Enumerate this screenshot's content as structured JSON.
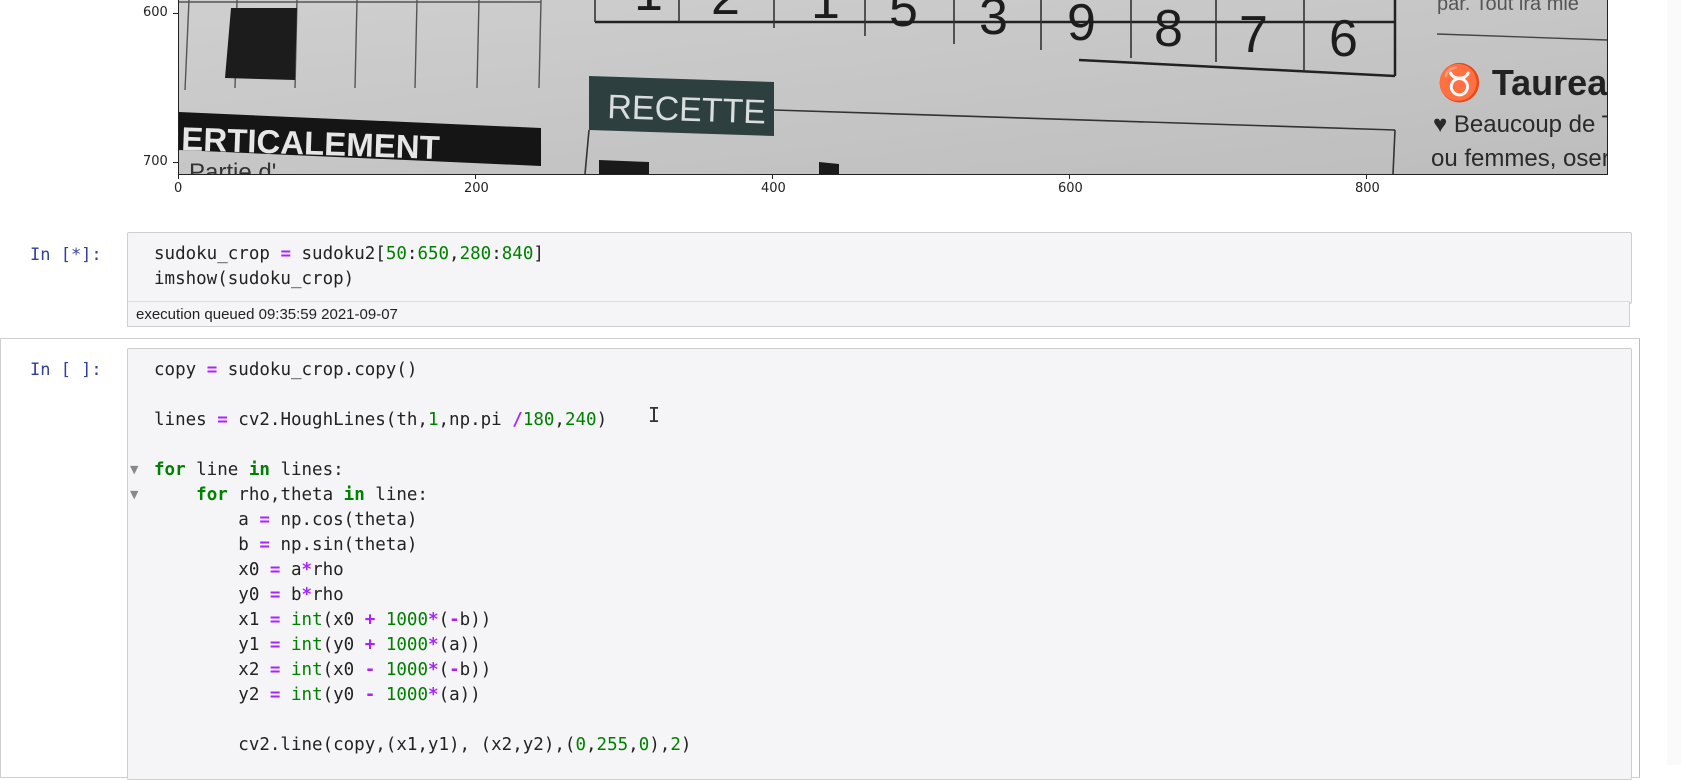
{
  "plot": {
    "y_ticks": [
      "600",
      "700"
    ],
    "x_ticks": [
      "0",
      "200",
      "400",
      "600",
      "800"
    ],
    "photo_text": {
      "verticalement": "ERTICALEMENT",
      "partie": "Partie d'",
      "recette": "RECETTE",
      "taureau": "♉ Taureau",
      "beaucoup": "♥ Beaucoup de Ta",
      "femmes": "ou femmes, osere",
      "tout": "par. Tout ira mie",
      "digits": [
        "1",
        "2",
        "1",
        "5",
        "3",
        "9",
        "8",
        "7",
        "6"
      ]
    }
  },
  "cells": [
    {
      "prompt": "In [*]:",
      "lines": [
        [
          {
            "t": "sudoku_crop "
          },
          {
            "t": "=",
            "c": "o"
          },
          {
            "t": " sudoku2["
          },
          {
            "t": "50",
            "c": "n"
          },
          {
            "t": ":"
          },
          {
            "t": "650",
            "c": "n"
          },
          {
            "t": ","
          },
          {
            "t": "280",
            "c": "n"
          },
          {
            "t": ":"
          },
          {
            "t": "840",
            "c": "n"
          },
          {
            "t": "]"
          }
        ],
        [
          {
            "t": "imshow(sudoku_crop)"
          }
        ]
      ],
      "status": "execution queued 09:35:59 2021-09-07"
    },
    {
      "prompt": "In [ ]:",
      "lines": [
        [
          {
            "t": "copy "
          },
          {
            "t": "=",
            "c": "o"
          },
          {
            "t": " sudoku_crop.copy()"
          }
        ],
        [],
        [
          {
            "t": "lines "
          },
          {
            "t": "=",
            "c": "o"
          },
          {
            "t": " cv2.HoughLines(th,"
          },
          {
            "t": "1",
            "c": "n"
          },
          {
            "t": ",np.pi "
          },
          {
            "t": "/",
            "c": "o"
          },
          {
            "t": "180",
            "c": "n"
          },
          {
            "t": ","
          },
          {
            "t": "240",
            "c": "n"
          },
          {
            "t": ")"
          }
        ],
        [],
        [
          {
            "t": "for",
            "c": "k"
          },
          {
            "t": " line "
          },
          {
            "t": "in",
            "c": "k"
          },
          {
            "t": " lines:"
          }
        ],
        [
          {
            "t": "    "
          },
          {
            "t": "for",
            "c": "k"
          },
          {
            "t": " rho,theta "
          },
          {
            "t": "in",
            "c": "k"
          },
          {
            "t": " line:"
          }
        ],
        [
          {
            "t": "        a "
          },
          {
            "t": "=",
            "c": "o"
          },
          {
            "t": " np.cos(theta)"
          }
        ],
        [
          {
            "t": "        b "
          },
          {
            "t": "=",
            "c": "o"
          },
          {
            "t": " np.sin(theta)"
          }
        ],
        [
          {
            "t": "        x0 "
          },
          {
            "t": "=",
            "c": "o"
          },
          {
            "t": " a"
          },
          {
            "t": "*",
            "c": "o"
          },
          {
            "t": "rho"
          }
        ],
        [
          {
            "t": "        y0 "
          },
          {
            "t": "=",
            "c": "o"
          },
          {
            "t": " b"
          },
          {
            "t": "*",
            "c": "o"
          },
          {
            "t": "rho"
          }
        ],
        [
          {
            "t": "        x1 "
          },
          {
            "t": "=",
            "c": "o"
          },
          {
            "t": " "
          },
          {
            "t": "int",
            "c": "b"
          },
          {
            "t": "(x0 "
          },
          {
            "t": "+",
            "c": "o"
          },
          {
            "t": " "
          },
          {
            "t": "1000",
            "c": "n"
          },
          {
            "t": "*",
            "c": "o"
          },
          {
            "t": "("
          },
          {
            "t": "-",
            "c": "o"
          },
          {
            "t": "b))"
          }
        ],
        [
          {
            "t": "        y1 "
          },
          {
            "t": "=",
            "c": "o"
          },
          {
            "t": " "
          },
          {
            "t": "int",
            "c": "b"
          },
          {
            "t": "(y0 "
          },
          {
            "t": "+",
            "c": "o"
          },
          {
            "t": " "
          },
          {
            "t": "1000",
            "c": "n"
          },
          {
            "t": "*",
            "c": "o"
          },
          {
            "t": "(a))"
          }
        ],
        [
          {
            "t": "        x2 "
          },
          {
            "t": "=",
            "c": "o"
          },
          {
            "t": " "
          },
          {
            "t": "int",
            "c": "b"
          },
          {
            "t": "(x0 "
          },
          {
            "t": "-",
            "c": "o"
          },
          {
            "t": " "
          },
          {
            "t": "1000",
            "c": "n"
          },
          {
            "t": "*",
            "c": "o"
          },
          {
            "t": "("
          },
          {
            "t": "-",
            "c": "o"
          },
          {
            "t": "b))"
          }
        ],
        [
          {
            "t": "        y2 "
          },
          {
            "t": "=",
            "c": "o"
          },
          {
            "t": " "
          },
          {
            "t": "int",
            "c": "b"
          },
          {
            "t": "(y0 "
          },
          {
            "t": "-",
            "c": "o"
          },
          {
            "t": " "
          },
          {
            "t": "1000",
            "c": "n"
          },
          {
            "t": "*",
            "c": "o"
          },
          {
            "t": "(a))"
          }
        ],
        [],
        [
          {
            "t": "        cv2.line(copy,(x1,y1), (x2,y2),("
          },
          {
            "t": "0",
            "c": "n"
          },
          {
            "t": ","
          },
          {
            "t": "255",
            "c": "n"
          },
          {
            "t": ","
          },
          {
            "t": "0",
            "c": "n"
          },
          {
            "t": "),"
          },
          {
            "t": "2",
            "c": "n"
          },
          {
            "t": ")"
          }
        ]
      ],
      "fold_markers": [
        "▼",
        "▼"
      ]
    }
  ]
}
